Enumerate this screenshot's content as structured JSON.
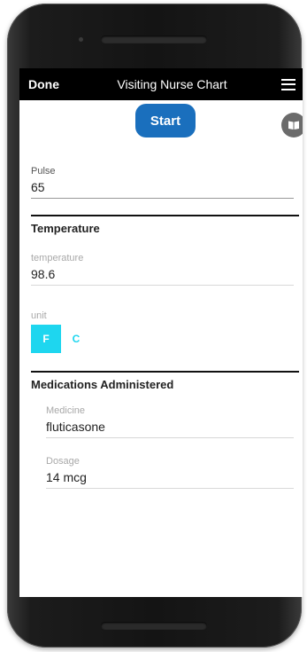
{
  "header": {
    "done_label": "Done",
    "title": "Visiting Nurse Chart",
    "menu_icon": "hamburger-menu-icon"
  },
  "actions": {
    "start_label": "Start",
    "book_icon": "open-book-icon"
  },
  "pulse": {
    "label": "Pulse",
    "value": "65"
  },
  "temperature_section": {
    "title": "Temperature",
    "temperature_label": "temperature",
    "temperature_value": "98.6",
    "unit_label": "unit",
    "unit_options": [
      "F",
      "C"
    ],
    "selected_unit": "F"
  },
  "medications_section": {
    "title": "Medications Administered",
    "medicine_label": "Medicine",
    "medicine_value": "fluticasone",
    "dosage_label": "Dosage",
    "dosage_value": "14 mcg"
  },
  "colors": {
    "start_button": "#1a6fbd",
    "toggle_accent": "#1ed6ef",
    "appbar": "#000000"
  }
}
